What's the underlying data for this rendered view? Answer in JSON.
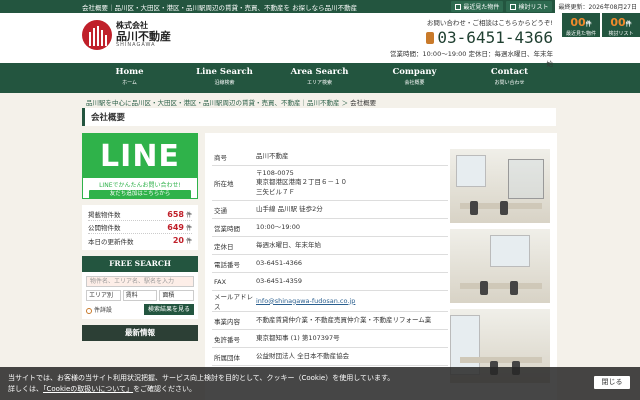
{
  "topbar": {
    "text": "会社概要｜品川区・大田区・港区・品川駅周辺の賃貸・売買、不動産を お探しなら品川不動産",
    "viewed_label": "最近見た物件",
    "review_label": "検討リスト",
    "date": "最終更新：2026年08月27日"
  },
  "logo": {
    "line1": "株式会社",
    "line2": "品川不動産",
    "line3": "SHINAGAWA"
  },
  "contact": {
    "lead": "お問い合わせ・ご相談はこちらからどうぞ!",
    "tel": "03-6451-4366",
    "hours": "営業時間：10:00～19:00 定休日：毎週水曜日、年末年始"
  },
  "counters": [
    {
      "num": "00",
      "unit": "件",
      "label": "最近見た物件"
    },
    {
      "num": "00",
      "unit": "件",
      "label": "検討リスト"
    }
  ],
  "nav": [
    {
      "en": "Home",
      "jp": "ホーム"
    },
    {
      "en": "Line Search",
      "jp": "沿線検索"
    },
    {
      "en": "Area Search",
      "jp": "エリア検索"
    },
    {
      "en": "Company",
      "jp": "会社概要"
    },
    {
      "en": "Contact",
      "jp": "お問い合わせ"
    }
  ],
  "breadcrumb": {
    "home": "品川駅を中心に品川区・大田区・港区・品川駅周辺の賃貸・売買、不動産｜品川不動産",
    "sep": " ＞ ",
    "current": "会社概要"
  },
  "page_title": "会社概要",
  "line_banner": {
    "big": "LINE",
    "sub": "LINEでかんたんお問い合わせ!",
    "btn": "友だち追加はこちらから"
  },
  "stats": [
    {
      "label": "掲載物件数",
      "value": "658",
      "unit": "件"
    },
    {
      "label": "公開物件数",
      "value": "649",
      "unit": "件"
    },
    {
      "label": "本日の更新件数",
      "value": "20",
      "unit": "件"
    }
  ],
  "free_search": {
    "title": "FREE SEARCH",
    "placeholder": "物件名、エリア名、駅名を入力",
    "sel1": "エリア別",
    "sel2": "賃料",
    "sel3": "面積",
    "link": "件詳設",
    "go": "検索結果を見る"
  },
  "news": {
    "title": "最新情報"
  },
  "info": [
    {
      "k": "商号",
      "v": "品川不動産"
    },
    {
      "k": "所在地",
      "v": "〒108-0075\n東京都港区港南２丁目６－１０\n三矢ビル７Ｆ"
    },
    {
      "k": "交通",
      "v": "山手線 品川駅 徒歩2分"
    },
    {
      "k": "営業時間",
      "v": "10:00～19:00"
    },
    {
      "k": "定休日",
      "v": "毎週水曜日、年末年始"
    },
    {
      "k": "電話番号",
      "v": "03-6451-4366"
    },
    {
      "k": "FAX",
      "v": "03-6451-4359"
    },
    {
      "k": "メールアドレス",
      "v": "info@shinagawa-fudosan.co.jp",
      "link": true
    },
    {
      "k": "事業内容",
      "v": "不動産賃貸仲介業・不動産売買仲介業・不動産リフォーム業"
    },
    {
      "k": "免許番号",
      "v": "東京都知事 (1) 第107397号"
    },
    {
      "k": "所属団体",
      "v": "公益財団法人 全日本不動産協会"
    }
  ],
  "cookie": {
    "text1": "当サイトでは、お客様の当サイト利用状況把握、サービス向上検討を目的として、クッキー（Cookie）を使用しています。",
    "text2a": "詳しくは、",
    "link": "「Cookieの取扱いについて」",
    "text2b": "をご確認ください。",
    "close": "閉じる"
  }
}
